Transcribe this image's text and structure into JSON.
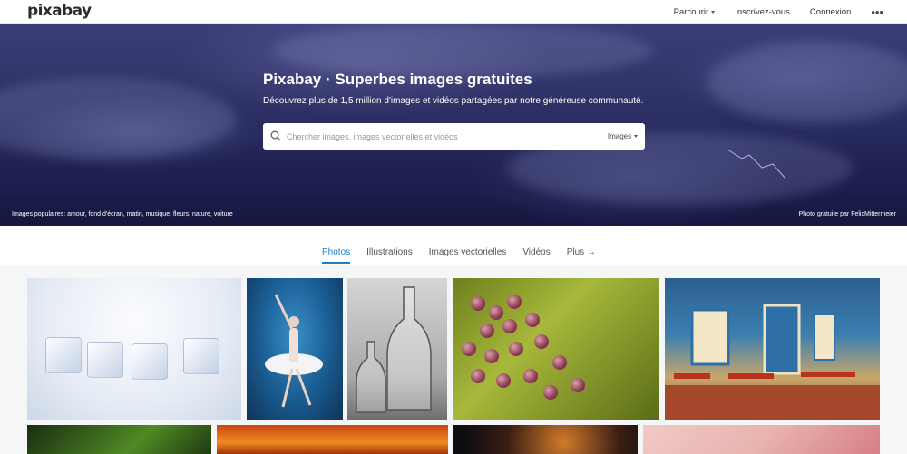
{
  "header": {
    "logo": "pixabay",
    "nav": {
      "browse": "Parcourir",
      "signup": "Inscrivez-vous",
      "login": "Connexion",
      "more": "•••"
    }
  },
  "hero": {
    "title": "Pixabay · Superbes images gratuites",
    "subtitle": "Découvrez plus de 1,5 million d'images et vidéos partagées par notre généreuse communauté.",
    "search": {
      "placeholder": "Chercher images, images vectorielles et vidéos",
      "type_label": "Images"
    },
    "popular": "Images populaires: amour, fond d'écran, matin, musique, fleurs, nature, voiture",
    "credit": "Photo gratuite par FelixMittermeier"
  },
  "tabs": [
    {
      "label": "Photos",
      "active": true
    },
    {
      "label": "Illustrations",
      "active": false
    },
    {
      "label": "Images vectorielles",
      "active": false
    },
    {
      "label": "Vidéos",
      "active": false
    },
    {
      "label": "Plus →",
      "active": false
    }
  ],
  "colors": {
    "accent": "#1f7cc8",
    "hero_dark": "#1e2050",
    "page_bg": "#f5f6f7"
  },
  "icons": {
    "search": "search-icon",
    "caret": "caret-down-icon",
    "more": "more-icon"
  }
}
